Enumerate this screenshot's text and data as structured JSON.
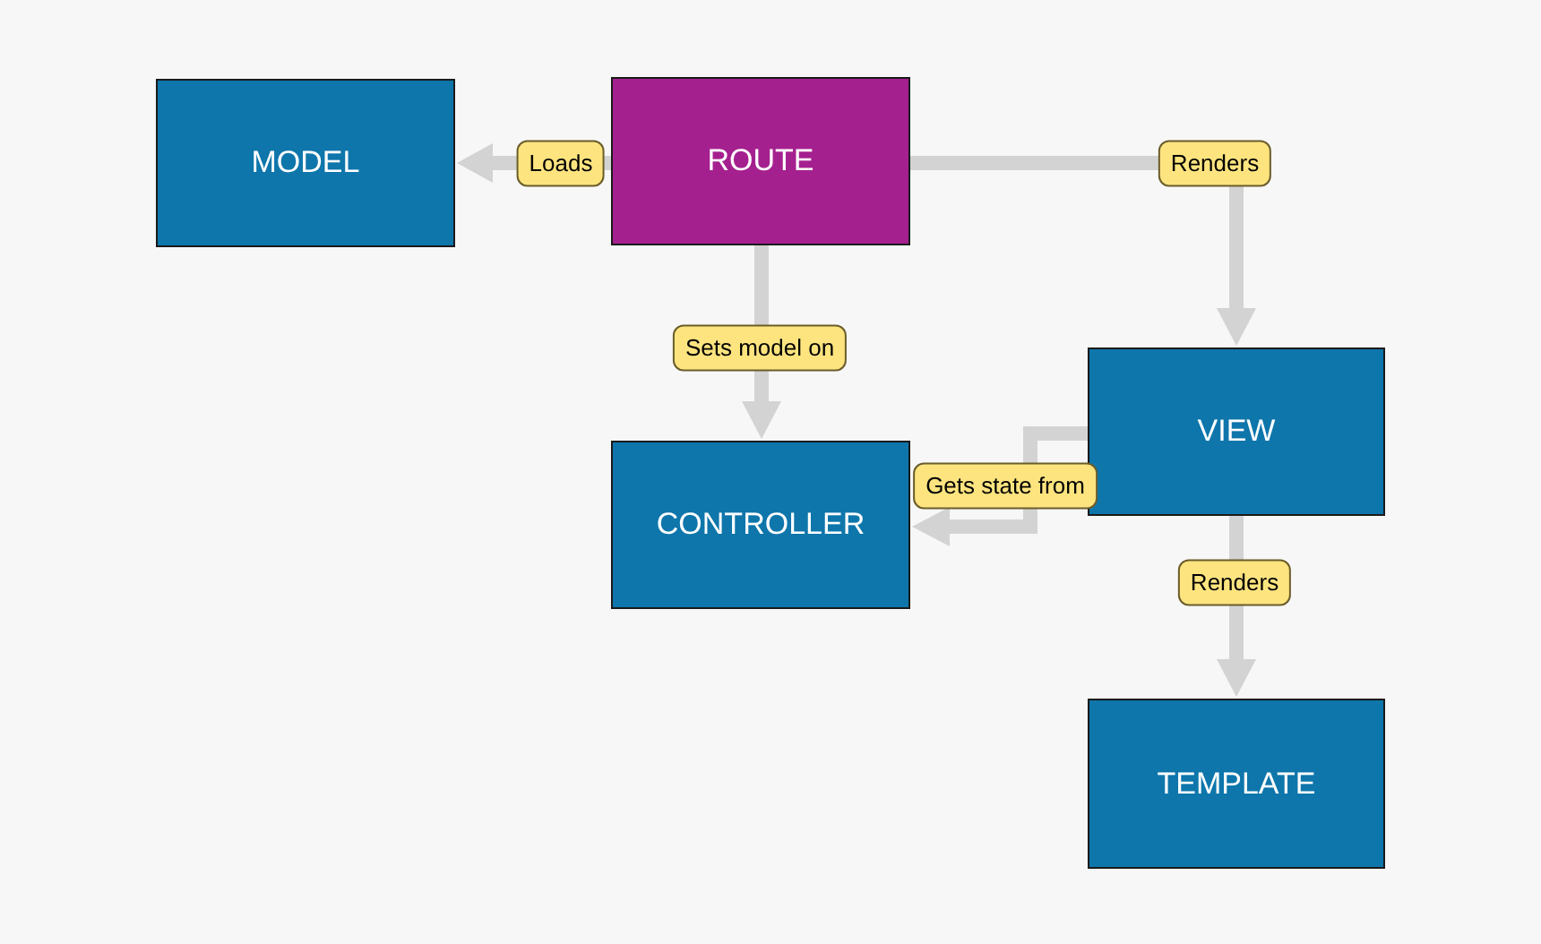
{
  "nodes": [
    {
      "label": "MODEL",
      "color": "#0e76ab"
    },
    {
      "label": "ROUTE",
      "color": "#a5208f"
    },
    {
      "label": "CONTROLLER",
      "color": "#0e76ab"
    },
    {
      "label": "VIEW",
      "color": "#0e76ab"
    },
    {
      "label": "TEMPLATE",
      "color": "#0e76ab"
    }
  ],
  "edges": [
    {
      "label": "Loads"
    },
    {
      "label": "Renders"
    },
    {
      "label": "Sets model on"
    },
    {
      "label": "Gets state from"
    },
    {
      "label": "Renders"
    }
  ]
}
